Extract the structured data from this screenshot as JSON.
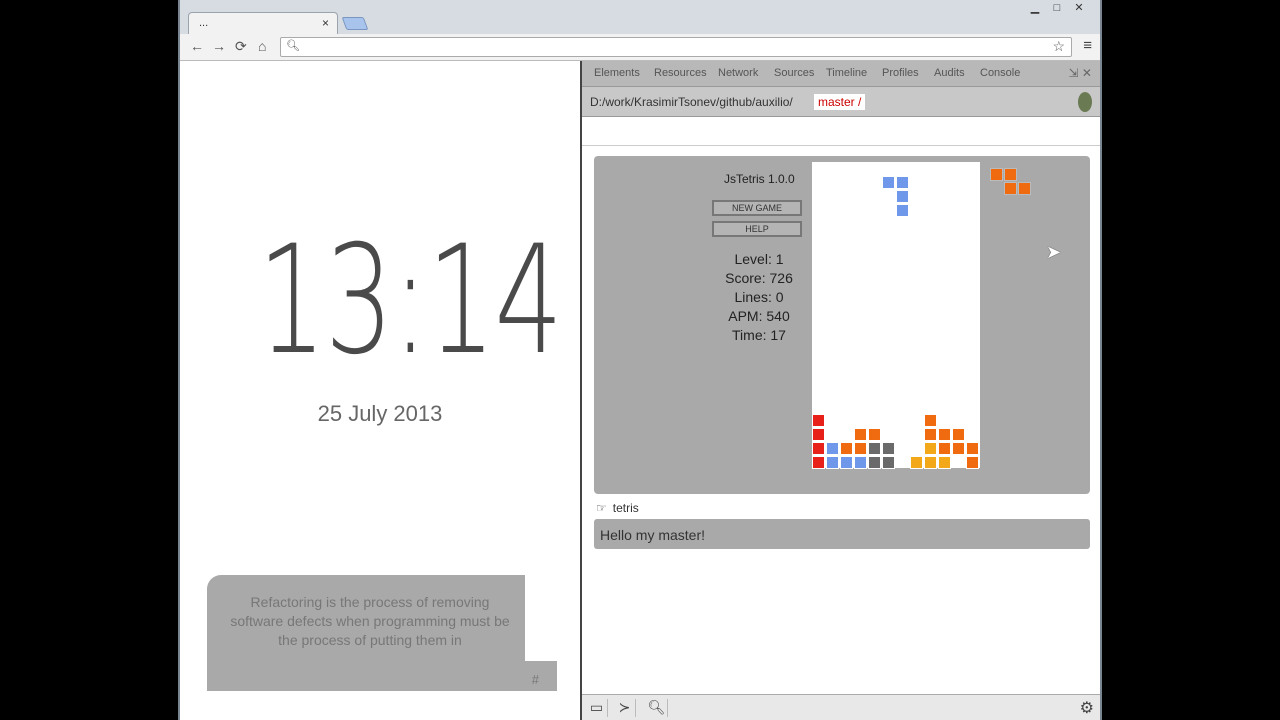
{
  "browser": {
    "tab_title": "...",
    "tab_close": "×",
    "window_controls": [
      "▁",
      "□",
      "✕"
    ],
    "nav": {
      "back": "←",
      "forward": "→",
      "reload": "⟳",
      "home": "⌂"
    },
    "omnibox_value": "",
    "star": "☆",
    "menu": "≡"
  },
  "clock": {
    "time": "13:14",
    "date": "25 July 2013"
  },
  "chat_bubble": {
    "text": "Refactoring is the process of removing software defects when programming must be the process of putting them in",
    "hash": "#"
  },
  "devtools": {
    "tabs": [
      "Elements",
      "Resources",
      "Network",
      "Sources",
      "Timeline",
      "Profiles",
      "Audits",
      "Console"
    ],
    "path": "D:/work/KrasimirTsonev/github/auxilio/",
    "branch": "master /"
  },
  "tetris": {
    "title": "JsTetris 1.0.0",
    "new_game": "NEW GAME",
    "help": "HELP",
    "level": "Level: 1",
    "score": "Score: 726",
    "lines": "Lines: 0",
    "apm": "APM: 540",
    "time": "Time: 17",
    "colors": {
      "red": "#e8201a",
      "orange": "#f06a10",
      "blue": "#6f97ea",
      "gray": "#6a6a6a",
      "yellow": "#f2a818"
    }
  },
  "console": {
    "command": "tetris",
    "reply": "Hello my master!"
  }
}
